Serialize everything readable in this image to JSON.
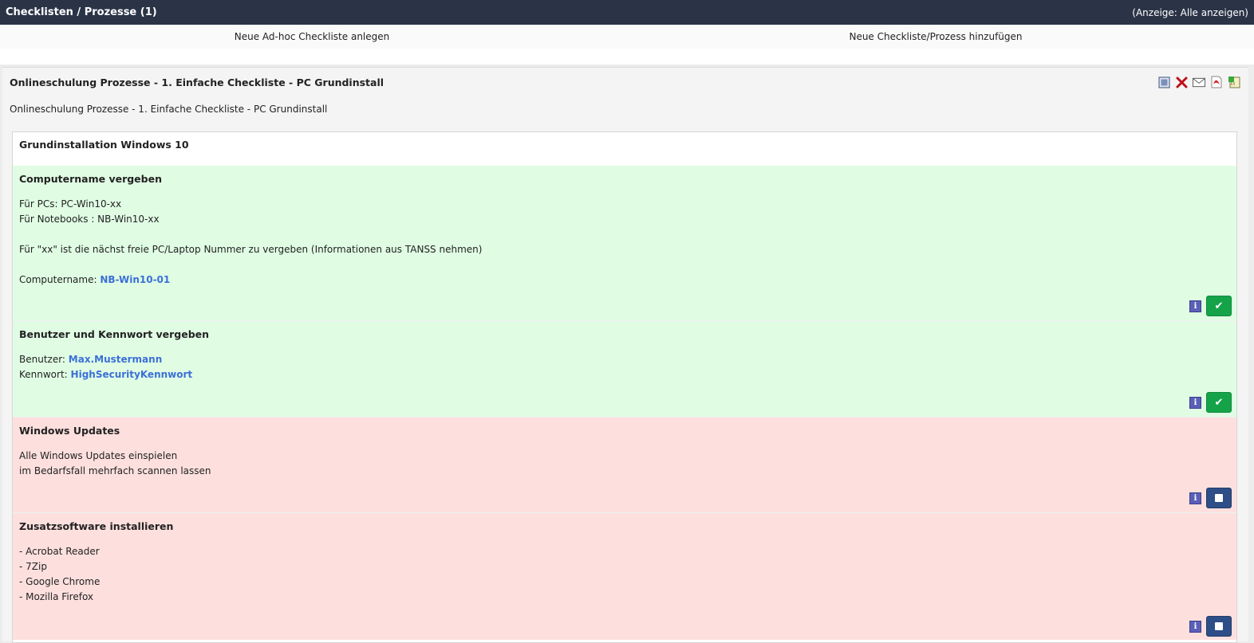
{
  "header": {
    "title": "Checklisten / Prozesse (1)",
    "filter": "(Anzeige: Alle anzeigen)"
  },
  "actions": {
    "new_adhoc": "Neue Ad-hoc Checkliste anlegen",
    "add_checklist": "Neue Checkliste/Prozess hinzufügen"
  },
  "checklist": {
    "title": "Onlineschulung Prozesse - 1. Einfache Checkliste - PC Grundinstall",
    "subtitle": "Onlineschulung Prozesse - 1. Einfache Checkliste - PC Grundinstall",
    "toolbar_icons": [
      "edit-icon",
      "delete-icon",
      "mail-icon",
      "pdf-icon",
      "export-icon"
    ],
    "group_title": "Grundinstallation Windows 10",
    "steps": [
      {
        "title": "Computername vergeben",
        "status": "done",
        "lines": [
          {
            "text": "Für PCs: PC-Win10-xx",
            "value": ""
          },
          {
            "text": "Für Notebooks : NB-Win10-xx",
            "value": ""
          },
          {
            "text": "",
            "value": ""
          },
          {
            "text": "Für \"xx\" ist die nächst freie PC/Laptop Nummer zu vergeben (Informationen aus TANSS nehmen)",
            "value": ""
          },
          {
            "text": "",
            "value": ""
          },
          {
            "text": "Computername: ",
            "value": "NB-Win10-01"
          }
        ]
      },
      {
        "title": "Benutzer und Kennwort vergeben",
        "status": "done",
        "lines": [
          {
            "text": "Benutzer: ",
            "value": "Max.Mustermann"
          },
          {
            "text": "Kennwort: ",
            "value": "HighSecurityKennwort"
          }
        ]
      },
      {
        "title": "Windows Updates",
        "status": "open",
        "lines": [
          {
            "text": "Alle Windows Updates einspielen",
            "value": ""
          },
          {
            "text": "im Bedarfsfall mehrfach scannen lassen",
            "value": ""
          }
        ]
      },
      {
        "title": "Zusatzsoftware installieren",
        "status": "open",
        "lines": [
          {
            "text": "- Acrobat Reader",
            "value": ""
          },
          {
            "text": "- 7Zip",
            "value": ""
          },
          {
            "text": "- Google Chrome",
            "value": ""
          },
          {
            "text": "- Mozilla Firefox",
            "value": ""
          }
        ]
      }
    ]
  },
  "colors": {
    "topbar": "#2b3347",
    "done_bg": "#e0fde4",
    "open_bg": "#fde0de",
    "value_text": "#3c6fd8",
    "check_on": "#15a34a",
    "check_off": "#2d4e86"
  }
}
